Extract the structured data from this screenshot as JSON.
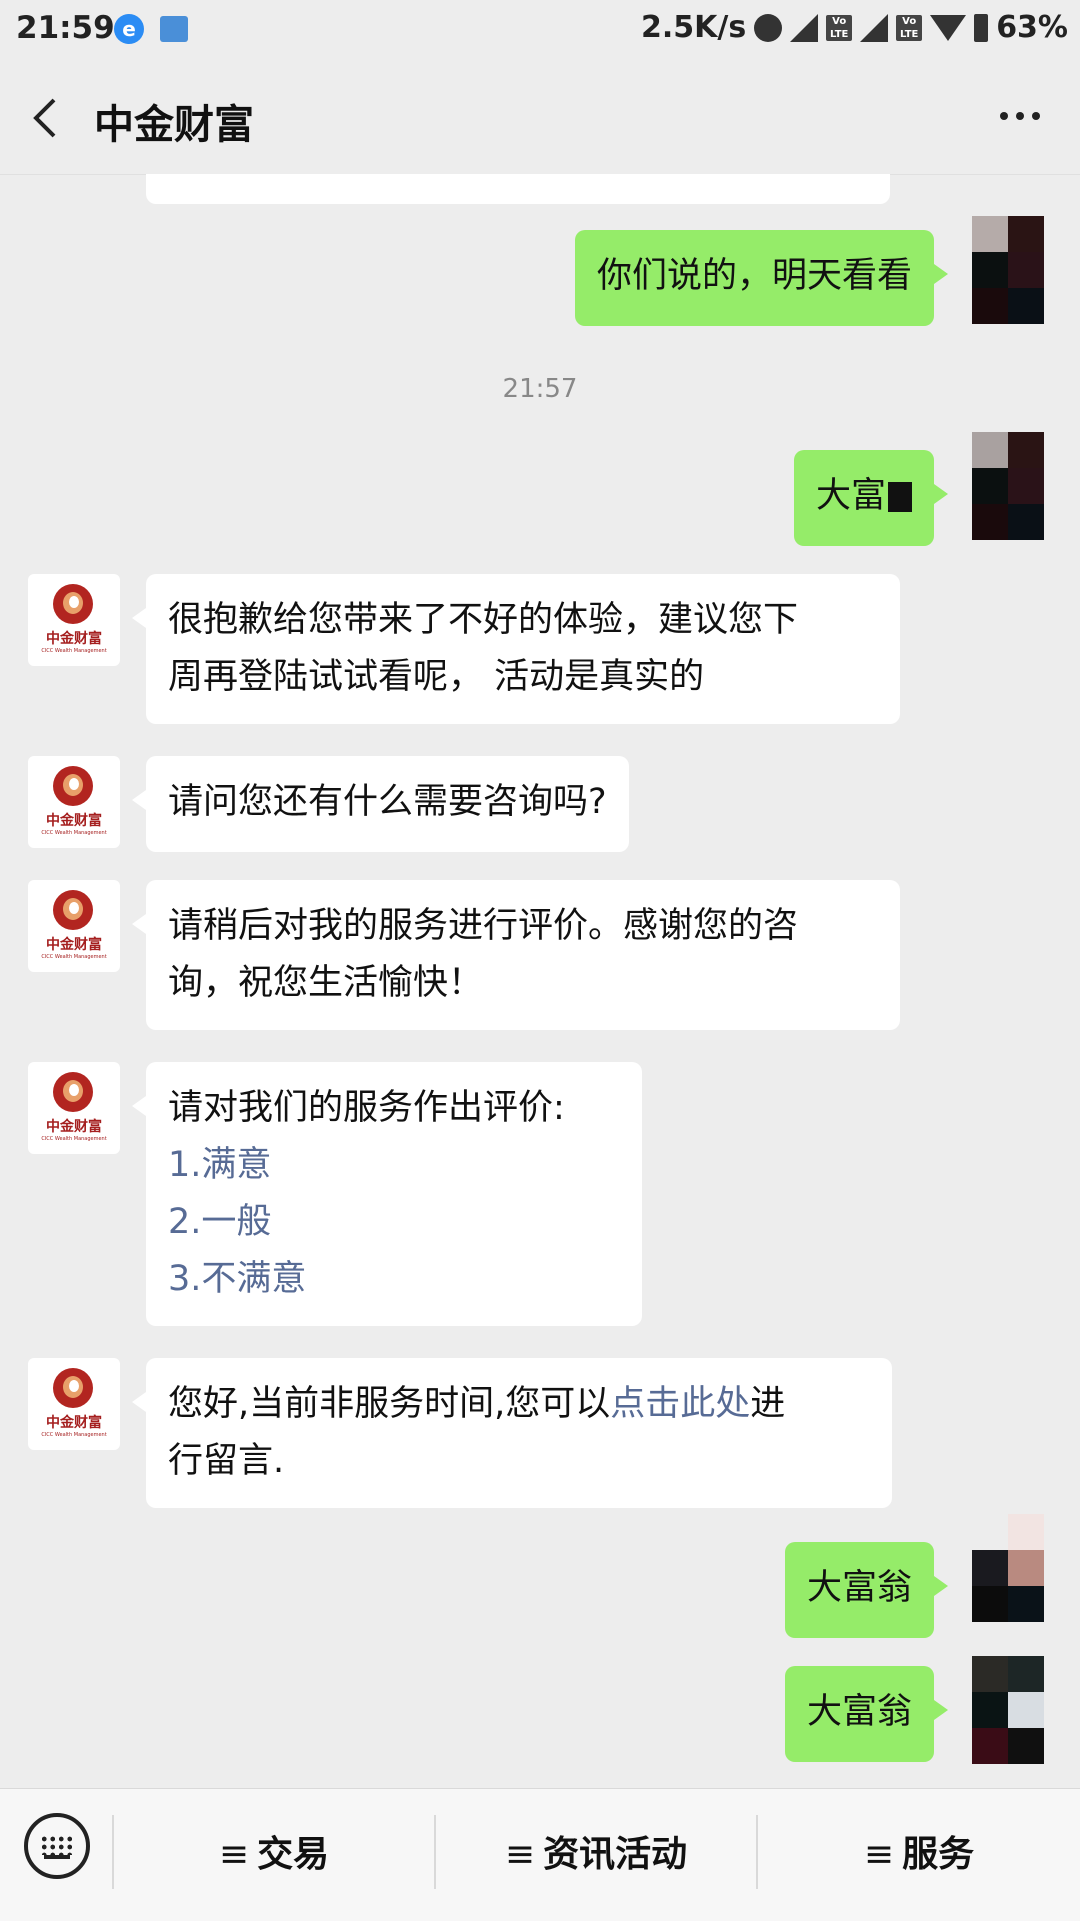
{
  "status_bar": {
    "time": "21:59",
    "speed": "2.5K/s",
    "battery": "63%",
    "lte1": "Vo LTE",
    "lte2": "Vo LTE"
  },
  "header": {
    "title": "中金财富",
    "back_icon": "chevron-left-icon",
    "more_icon": "more-dots-icon"
  },
  "chat": {
    "messages": [
      {
        "from": "user",
        "text": "你们说的，明天看看"
      },
      {
        "timestamp": "21:57"
      },
      {
        "from": "user",
        "text": "大富"
      },
      {
        "from": "bot",
        "lines": [
          "很抱歉给您带来了不好的体验，建议您下",
          "周再登陆试试看呢， 活动是真实的"
        ]
      },
      {
        "from": "bot",
        "text": "请问您还有什么需要咨询吗?"
      },
      {
        "from": "bot",
        "lines": [
          "请稍后对我的服务进行评价。感谢您的咨",
          "询，祝您生活愉快！"
        ]
      },
      {
        "from": "bot",
        "heading": "请对我们的服务作出评价:",
        "options": [
          "1.满意",
          "2.一般",
          "3.不满意"
        ]
      },
      {
        "from": "bot",
        "line1_pre": "您好,当前非服务时间,您可以",
        "line1_link": "点击此处",
        "line1_post": "进",
        "line2": "行留言."
      },
      {
        "from": "user",
        "text": "大富翁"
      },
      {
        "from": "user",
        "text": "大富翁"
      }
    ],
    "bot_avatar": {
      "name": "中金财富",
      "sub": "CICC Wealth Management"
    }
  },
  "bottom_menu": {
    "keyboard_icon": "keyboard-icon",
    "items": [
      {
        "label": "交易"
      },
      {
        "label": "资讯活动"
      },
      {
        "label": "服务"
      }
    ],
    "menu_glyph": "≡"
  },
  "colors": {
    "user_bubble": "#95ec69",
    "bot_bubble": "#ffffff",
    "background": "#ededed",
    "link": "#576b95"
  }
}
